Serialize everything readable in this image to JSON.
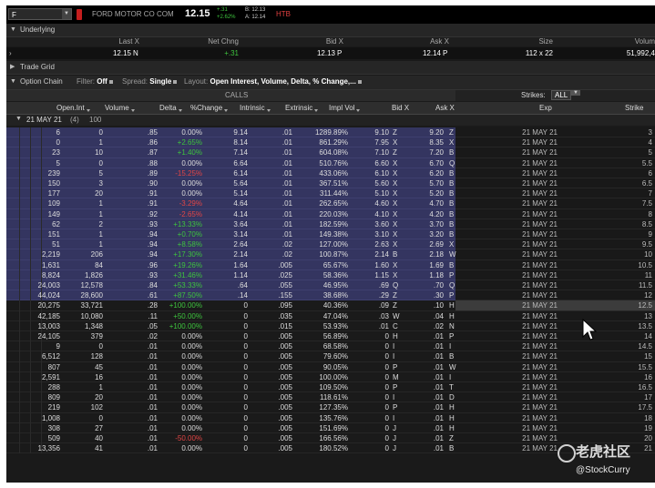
{
  "topbar": {
    "symbol": "F",
    "company": "FORD MOTOR CO COM",
    "last": "12.15",
    "change_abs": "+.31",
    "change_pct": "+2.62%",
    "bid": "B: 12.13",
    "ask": "A: 12.14",
    "htb": "HTB"
  },
  "underlying": {
    "title": "Underlying",
    "cols": [
      "Last X",
      "Net Chng",
      "Bid X",
      "Ask X",
      "Size",
      "Volum"
    ],
    "values": {
      "last": "12.15",
      "last_x": "N",
      "net_chng": "+.31",
      "bid": "12.13",
      "bid_x": "P",
      "ask": "12.14",
      "ask_x": "P",
      "size": "112 x 22",
      "volume": "51,992,4"
    }
  },
  "trade_grid": {
    "title": "Trade Grid"
  },
  "option_chain": {
    "title": "Option Chain",
    "filter_label": "Filter:",
    "filter_value": "Off",
    "spread_label": "Spread:",
    "spread_value": "Single",
    "layout_label": "Layout:",
    "layout_value": "Open Interest, Volume, Delta, % Change,...",
    "calls_label": "CALLS",
    "strikes_label": "Strikes:",
    "strikes_value": "ALL",
    "columns": [
      "Open.Int",
      "Volume",
      "Delta",
      "%Change",
      "Intrinsic",
      "Extrinsic",
      "Impl Vol",
      "Bid X",
      "Ask X",
      "Exp",
      "Strike"
    ],
    "expiration": {
      "label": "21 MAY 21",
      "count": "(4)",
      "multiplier": "100"
    }
  },
  "rows": [
    {
      "oi": "6",
      "vol": "0",
      "delta": ".85",
      "chg": "0.00%",
      "intr": "9.14",
      "extr": ".01",
      "iv": "1289.89%",
      "bid": "9.10",
      "bx": "Z",
      "ask": "9.20",
      "ax": "Z",
      "exp": "21 MAY 21",
      "strike": "3",
      "itm": true
    },
    {
      "oi": "0",
      "vol": "1",
      "delta": ".86",
      "chg": "+2.65%",
      "intr": "8.14",
      "extr": ".01",
      "iv": "861.29%",
      "bid": "7.95",
      "bx": "X",
      "ask": "8.35",
      "ax": "X",
      "exp": "21 MAY 21",
      "strike": "4",
      "itm": true
    },
    {
      "oi": "23",
      "vol": "10",
      "delta": ".87",
      "chg": "+1.40%",
      "intr": "7.14",
      "extr": ".01",
      "iv": "604.08%",
      "bid": "7.10",
      "bx": "Z",
      "ask": "7.20",
      "ax": "B",
      "exp": "21 MAY 21",
      "strike": "5",
      "itm": true
    },
    {
      "oi": "5",
      "vol": "0",
      "delta": ".88",
      "chg": "0.00%",
      "intr": "6.64",
      "extr": ".01",
      "iv": "510.76%",
      "bid": "6.60",
      "bx": "X",
      "ask": "6.70",
      "ax": "Q",
      "exp": "21 MAY 21",
      "strike": "5.5",
      "itm": true
    },
    {
      "oi": "239",
      "vol": "5",
      "delta": ".89",
      "chg": "-15.25%",
      "intr": "6.14",
      "extr": ".01",
      "iv": "433.06%",
      "bid": "6.10",
      "bx": "X",
      "ask": "6.20",
      "ax": "B",
      "exp": "21 MAY 21",
      "strike": "6",
      "itm": true
    },
    {
      "oi": "150",
      "vol": "3",
      "delta": ".90",
      "chg": "0.00%",
      "intr": "5.64",
      "extr": ".01",
      "iv": "367.51%",
      "bid": "5.60",
      "bx": "X",
      "ask": "5.70",
      "ax": "B",
      "exp": "21 MAY 21",
      "strike": "6.5",
      "itm": true
    },
    {
      "oi": "177",
      "vol": "20",
      "delta": ".91",
      "chg": "0.00%",
      "intr": "5.14",
      "extr": ".01",
      "iv": "311.44%",
      "bid": "5.10",
      "bx": "X",
      "ask": "5.20",
      "ax": "B",
      "exp": "21 MAY 21",
      "strike": "7",
      "itm": true
    },
    {
      "oi": "109",
      "vol": "1",
      "delta": ".91",
      "chg": "-3.29%",
      "intr": "4.64",
      "extr": ".01",
      "iv": "262.65%",
      "bid": "4.60",
      "bx": "X",
      "ask": "4.70",
      "ax": "B",
      "exp": "21 MAY 21",
      "strike": "7.5",
      "itm": true
    },
    {
      "oi": "149",
      "vol": "1",
      "delta": ".92",
      "chg": "-2.65%",
      "intr": "4.14",
      "extr": ".01",
      "iv": "220.03%",
      "bid": "4.10",
      "bx": "X",
      "ask": "4.20",
      "ax": "B",
      "exp": "21 MAY 21",
      "strike": "8",
      "itm": true
    },
    {
      "oi": "62",
      "vol": "2",
      "delta": ".93",
      "chg": "+13.33%",
      "intr": "3.64",
      "extr": ".01",
      "iv": "182.59%",
      "bid": "3.60",
      "bx": "X",
      "ask": "3.70",
      "ax": "B",
      "exp": "21 MAY 21",
      "strike": "8.5",
      "itm": true
    },
    {
      "oi": "151",
      "vol": "1",
      "delta": ".94",
      "chg": "+0.70%",
      "intr": "3.14",
      "extr": ".01",
      "iv": "149.38%",
      "bid": "3.10",
      "bx": "X",
      "ask": "3.20",
      "ax": "B",
      "exp": "21 MAY 21",
      "strike": "9",
      "itm": true
    },
    {
      "oi": "51",
      "vol": "1",
      "delta": ".94",
      "chg": "+8.58%",
      "intr": "2.64",
      "extr": ".02",
      "iv": "127.00%",
      "bid": "2.63",
      "bx": "X",
      "ask": "2.69",
      "ax": "X",
      "exp": "21 MAY 21",
      "strike": "9.5",
      "itm": true
    },
    {
      "oi": "2,219",
      "vol": "206",
      "delta": ".94",
      "chg": "+17.30%",
      "intr": "2.14",
      "extr": ".02",
      "iv": "100.87%",
      "bid": "2.14",
      "bx": "B",
      "ask": "2.18",
      "ax": "W",
      "exp": "21 MAY 21",
      "strike": "10",
      "itm": true
    },
    {
      "oi": "1,631",
      "vol": "84",
      "delta": ".96",
      "chg": "+19.26%",
      "intr": "1.64",
      "extr": ".005",
      "iv": "65.67%",
      "bid": "1.60",
      "bx": "X",
      "ask": "1.69",
      "ax": "B",
      "exp": "21 MAY 21",
      "strike": "10.5",
      "itm": true
    },
    {
      "oi": "8,824",
      "vol": "1,826",
      "delta": ".93",
      "chg": "+31.46%",
      "intr": "1.14",
      "extr": ".025",
      "iv": "58.36%",
      "bid": "1.15",
      "bx": "X",
      "ask": "1.18",
      "ax": "P",
      "exp": "21 MAY 21",
      "strike": "11",
      "itm": true
    },
    {
      "oi": "24,003",
      "vol": "12,578",
      "delta": ".84",
      "chg": "+53.33%",
      "intr": ".64",
      "extr": ".055",
      "iv": "46.95%",
      "bid": ".69",
      "bx": "Q",
      "ask": ".70",
      "ax": "Q",
      "exp": "21 MAY 21",
      "strike": "11.5",
      "itm": true
    },
    {
      "oi": "44,024",
      "vol": "28,600",
      "delta": ".61",
      "chg": "+87.50%",
      "intr": ".14",
      "extr": ".155",
      "iv": "38.68%",
      "bid": ".29",
      "bx": "Z",
      "ask": ".30",
      "ax": "P",
      "exp": "21 MAY 21",
      "strike": "12",
      "itm": true
    },
    {
      "oi": "20,275",
      "vol": "33,721",
      "delta": ".28",
      "chg": "+100.00%",
      "intr": "0",
      "extr": ".095",
      "iv": "40.36%",
      "bid": ".09",
      "bx": "Z",
      "ask": ".10",
      "ax": "H",
      "exp": "21 MAY 21",
      "strike": "12.5",
      "itm": false,
      "selected": true
    },
    {
      "oi": "42,185",
      "vol": "10,080",
      "delta": ".11",
      "chg": "+50.00%",
      "intr": "0",
      "extr": ".035",
      "iv": "47.04%",
      "bid": ".03",
      "bx": "W",
      "ask": ".04",
      "ax": "H",
      "exp": "21 MAY 21",
      "strike": "13",
      "itm": false
    },
    {
      "oi": "13,003",
      "vol": "1,348",
      "delta": ".05",
      "chg": "+100.00%",
      "intr": "0",
      "extr": ".015",
      "iv": "53.93%",
      "bid": ".01",
      "bx": "C",
      "ask": ".02",
      "ax": "N",
      "exp": "21 MAY 21",
      "strike": "13.5",
      "itm": false
    },
    {
      "oi": "24,105",
      "vol": "379",
      "delta": ".02",
      "chg": "0.00%",
      "intr": "0",
      "extr": ".005",
      "iv": "56.89%",
      "bid": "0",
      "bx": "H",
      "ask": ".01",
      "ax": "P",
      "exp": "21 MAY 21",
      "strike": "14",
      "itm": false
    },
    {
      "oi": "9",
      "vol": "0",
      "delta": ".01",
      "chg": "0.00%",
      "intr": "0",
      "extr": ".005",
      "iv": "68.58%",
      "bid": "0",
      "bx": "I",
      "ask": ".01",
      "ax": "I",
      "exp": "21 MAY 21",
      "strike": "14.5",
      "itm": false
    },
    {
      "oi": "6,512",
      "vol": "128",
      "delta": ".01",
      "chg": "0.00%",
      "intr": "0",
      "extr": ".005",
      "iv": "79.60%",
      "bid": "0",
      "bx": "I",
      "ask": ".01",
      "ax": "B",
      "exp": "21 MAY 21",
      "strike": "15",
      "itm": false
    },
    {
      "oi": "807",
      "vol": "45",
      "delta": ".01",
      "chg": "0.00%",
      "intr": "0",
      "extr": ".005",
      "iv": "90.05%",
      "bid": "0",
      "bx": "P",
      "ask": ".01",
      "ax": "W",
      "exp": "21 MAY 21",
      "strike": "15.5",
      "itm": false
    },
    {
      "oi": "2,591",
      "vol": "16",
      "delta": ".01",
      "chg": "0.00%",
      "intr": "0",
      "extr": ".005",
      "iv": "100.00%",
      "bid": "0",
      "bx": "M",
      "ask": ".01",
      "ax": "I",
      "exp": "21 MAY 21",
      "strike": "16",
      "itm": false
    },
    {
      "oi": "288",
      "vol": "1",
      "delta": ".01",
      "chg": "0.00%",
      "intr": "0",
      "extr": ".005",
      "iv": "109.50%",
      "bid": "0",
      "bx": "P",
      "ask": ".01",
      "ax": "T",
      "exp": "21 MAY 21",
      "strike": "16.5",
      "itm": false
    },
    {
      "oi": "809",
      "vol": "20",
      "delta": ".01",
      "chg": "0.00%",
      "intr": "0",
      "extr": ".005",
      "iv": "118.61%",
      "bid": "0",
      "bx": "I",
      "ask": ".01",
      "ax": "D",
      "exp": "21 MAY 21",
      "strike": "17",
      "itm": false
    },
    {
      "oi": "219",
      "vol": "102",
      "delta": ".01",
      "chg": "0.00%",
      "intr": "0",
      "extr": ".005",
      "iv": "127.35%",
      "bid": "0",
      "bx": "P",
      "ask": ".01",
      "ax": "H",
      "exp": "21 MAY 21",
      "strike": "17.5",
      "itm": false
    },
    {
      "oi": "1,008",
      "vol": "0",
      "delta": ".01",
      "chg": "0.00%",
      "intr": "0",
      "extr": ".005",
      "iv": "135.76%",
      "bid": "0",
      "bx": "I",
      "ask": ".01",
      "ax": "H",
      "exp": "21 MAY 21",
      "strike": "18",
      "itm": false
    },
    {
      "oi": "308",
      "vol": "27",
      "delta": ".01",
      "chg": "0.00%",
      "intr": "0",
      "extr": ".005",
      "iv": "151.69%",
      "bid": "0",
      "bx": "J",
      "ask": ".01",
      "ax": "H",
      "exp": "21 MAY 21",
      "strike": "19",
      "itm": false
    },
    {
      "oi": "509",
      "vol": "40",
      "delta": ".01",
      "chg": "-50.00%",
      "intr": "0",
      "extr": ".005",
      "iv": "166.56%",
      "bid": "0",
      "bx": "J",
      "ask": ".01",
      "ax": "Z",
      "exp": "21 MAY 21",
      "strike": "20",
      "itm": false
    },
    {
      "oi": "13,356",
      "vol": "41",
      "delta": ".01",
      "chg": "0.00%",
      "intr": "0",
      "extr": ".005",
      "iv": "180.52%",
      "bid": "0",
      "bx": "J",
      "ask": ".01",
      "ax": "B",
      "exp": "21 MAY 21",
      "strike": "21",
      "itm": false
    }
  ],
  "watermark": {
    "line1": "老虎社区",
    "line2": "@StockCurry"
  },
  "colors": {
    "itm_row": "#343560",
    "positive": "#3ec43e",
    "negative": "#e24646",
    "htb": "#e04040"
  }
}
